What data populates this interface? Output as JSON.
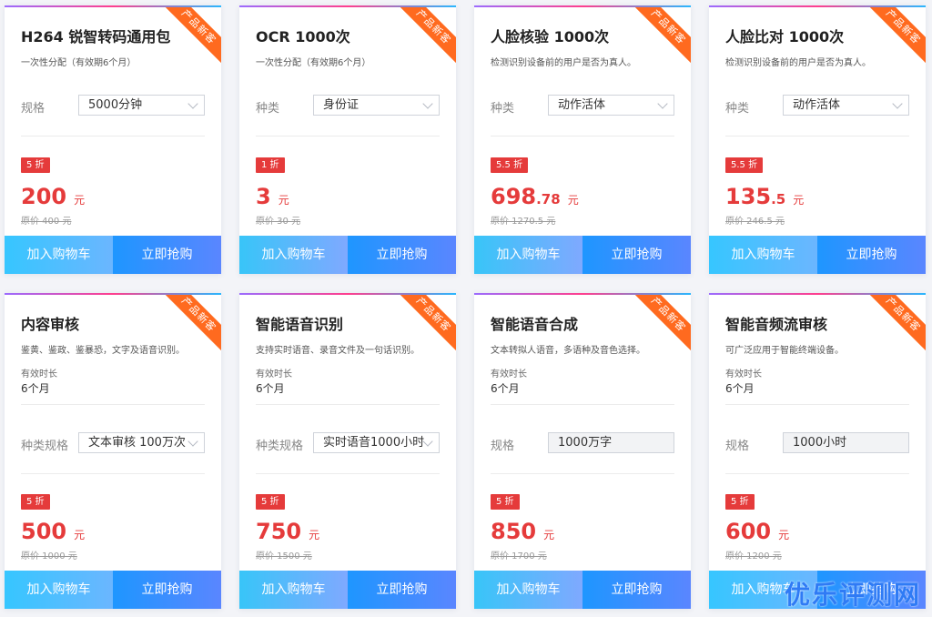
{
  "ribbon_label": "产品新客",
  "cart_label": "加入购物车",
  "buy_label": "立即抢购",
  "validity_label": "有效时长",
  "cards": [
    {
      "title": "H264 锐智转码通用包",
      "desc": "一次性分配（有效期6个月）",
      "spec_label": "规格",
      "spec_value": "5000分钟",
      "discount": "5 折",
      "price_main": "200",
      "price_dec": "",
      "unit": "元",
      "original": "原价 400 元"
    },
    {
      "title": "OCR 1000次",
      "desc": "一次性分配（有效期6个月）",
      "spec_label": "种类",
      "spec_value": "身份证",
      "discount": "1 折",
      "price_main": "3",
      "price_dec": "",
      "unit": "元",
      "original": "原价 30 元"
    },
    {
      "title": "人脸核验 1000次",
      "desc": "检测识别设备前的用户是否为真人。",
      "spec_label": "种类",
      "spec_value": "动作活体",
      "discount": "5.5 折",
      "price_main": "698",
      "price_dec": ".78",
      "unit": "元",
      "original": "原价 1270.5 元"
    },
    {
      "title": "人脸比对 1000次",
      "desc": "检测识别设备前的用户是否为真人。",
      "spec_label": "种类",
      "spec_value": "动作活体",
      "discount": "5.5 折",
      "price_main": "135",
      "price_dec": ".5",
      "unit": "元",
      "original": "原价 246.5 元"
    },
    {
      "title": "内容审核",
      "desc": "鉴黄、鉴政、鉴暴恐，文字及语音识别。",
      "validity": "6个月",
      "spec_label": "种类规格",
      "spec_value": "文本审核 100万次",
      "discount": "5 折",
      "price_main": "500",
      "price_dec": "",
      "unit": "元",
      "original": "原价 1000 元"
    },
    {
      "title": "智能语音识别",
      "desc": "支持实时语音、录音文件及一句话识别。",
      "validity": "6个月",
      "spec_label": "种类规格",
      "spec_value": "实时语音1000小时",
      "discount": "5 折",
      "price_main": "750",
      "price_dec": "",
      "unit": "元",
      "original": "原价 1500 元"
    },
    {
      "title": "智能语音合成",
      "desc": "文本转拟人语音，多语种及音色选择。",
      "validity": "6个月",
      "spec_label": "规格",
      "spec_value": "1000万字",
      "discount": "5 折",
      "price_main": "850",
      "price_dec": "",
      "unit": "元",
      "original": "原价 1700 元"
    },
    {
      "title": "智能音频流审核",
      "desc": "可广泛应用于智能终端设备。",
      "validity": "6个月",
      "spec_label": "规格",
      "spec_value": "1000小时",
      "discount": "5 折",
      "price_main": "600",
      "price_dec": "",
      "unit": "元",
      "original": "原价 1200 元"
    }
  ],
  "watermark": "优乐评测网"
}
